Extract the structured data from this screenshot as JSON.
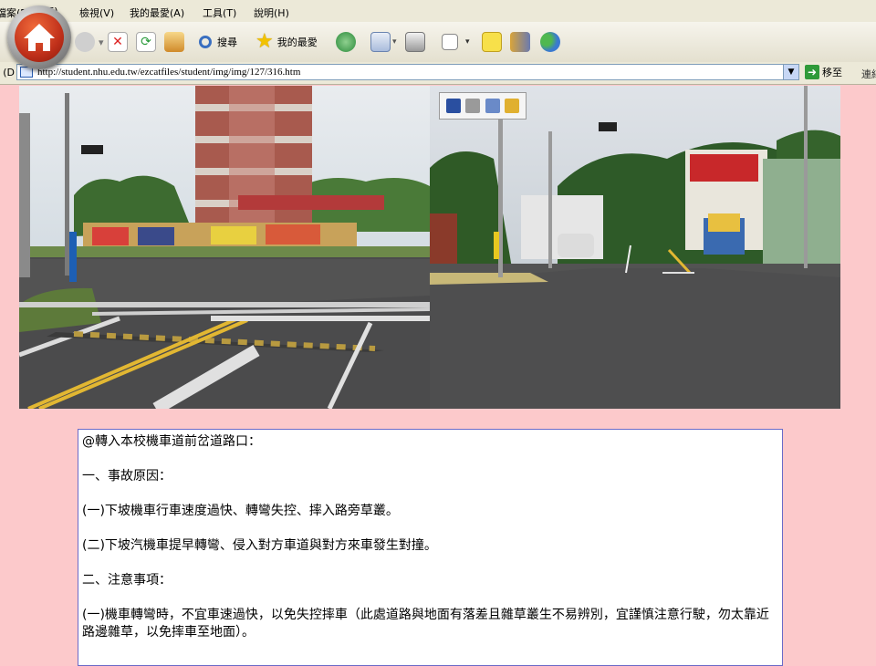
{
  "menu": {
    "items": [
      "檔案(F)",
      "(E)",
      "檢視(V)",
      "我的最愛(A)",
      "工具(T)",
      "說明(H)"
    ]
  },
  "toolbar": {
    "search_label": "搜尋",
    "favorites_label": "我的最愛"
  },
  "address": {
    "label": "網址(D)",
    "url": "http://student.nhu.edu.tw/ezcatfiles/student/img/img/127/316.htm",
    "go_label": "移至",
    "links_label": "連結"
  },
  "content": {
    "heading": "@轉入本校機車道前岔道路口：",
    "section1_title": "一、事故原因：",
    "section1_item1": "(一)下坡機車行車速度過快、轉彎失控、摔入路旁草叢。",
    "section1_item2": "(二)下坡汽機車提早轉彎、侵入對方車道與對方來車發生對撞。",
    "section2_title": "二、注意事項：",
    "section2_item1": "(一)機車轉彎時，不宜車速過快，以免失控摔車（此處道路與地面有落差且雜草叢生不易辨別，宜謹慎注意行駛，勿太靠近路邊雜草，以免摔車至地面）。"
  },
  "colors": {
    "page_background": "#fcc9cb",
    "textbox_border": "#6a6ac8",
    "home_badge": "#c0301a"
  }
}
